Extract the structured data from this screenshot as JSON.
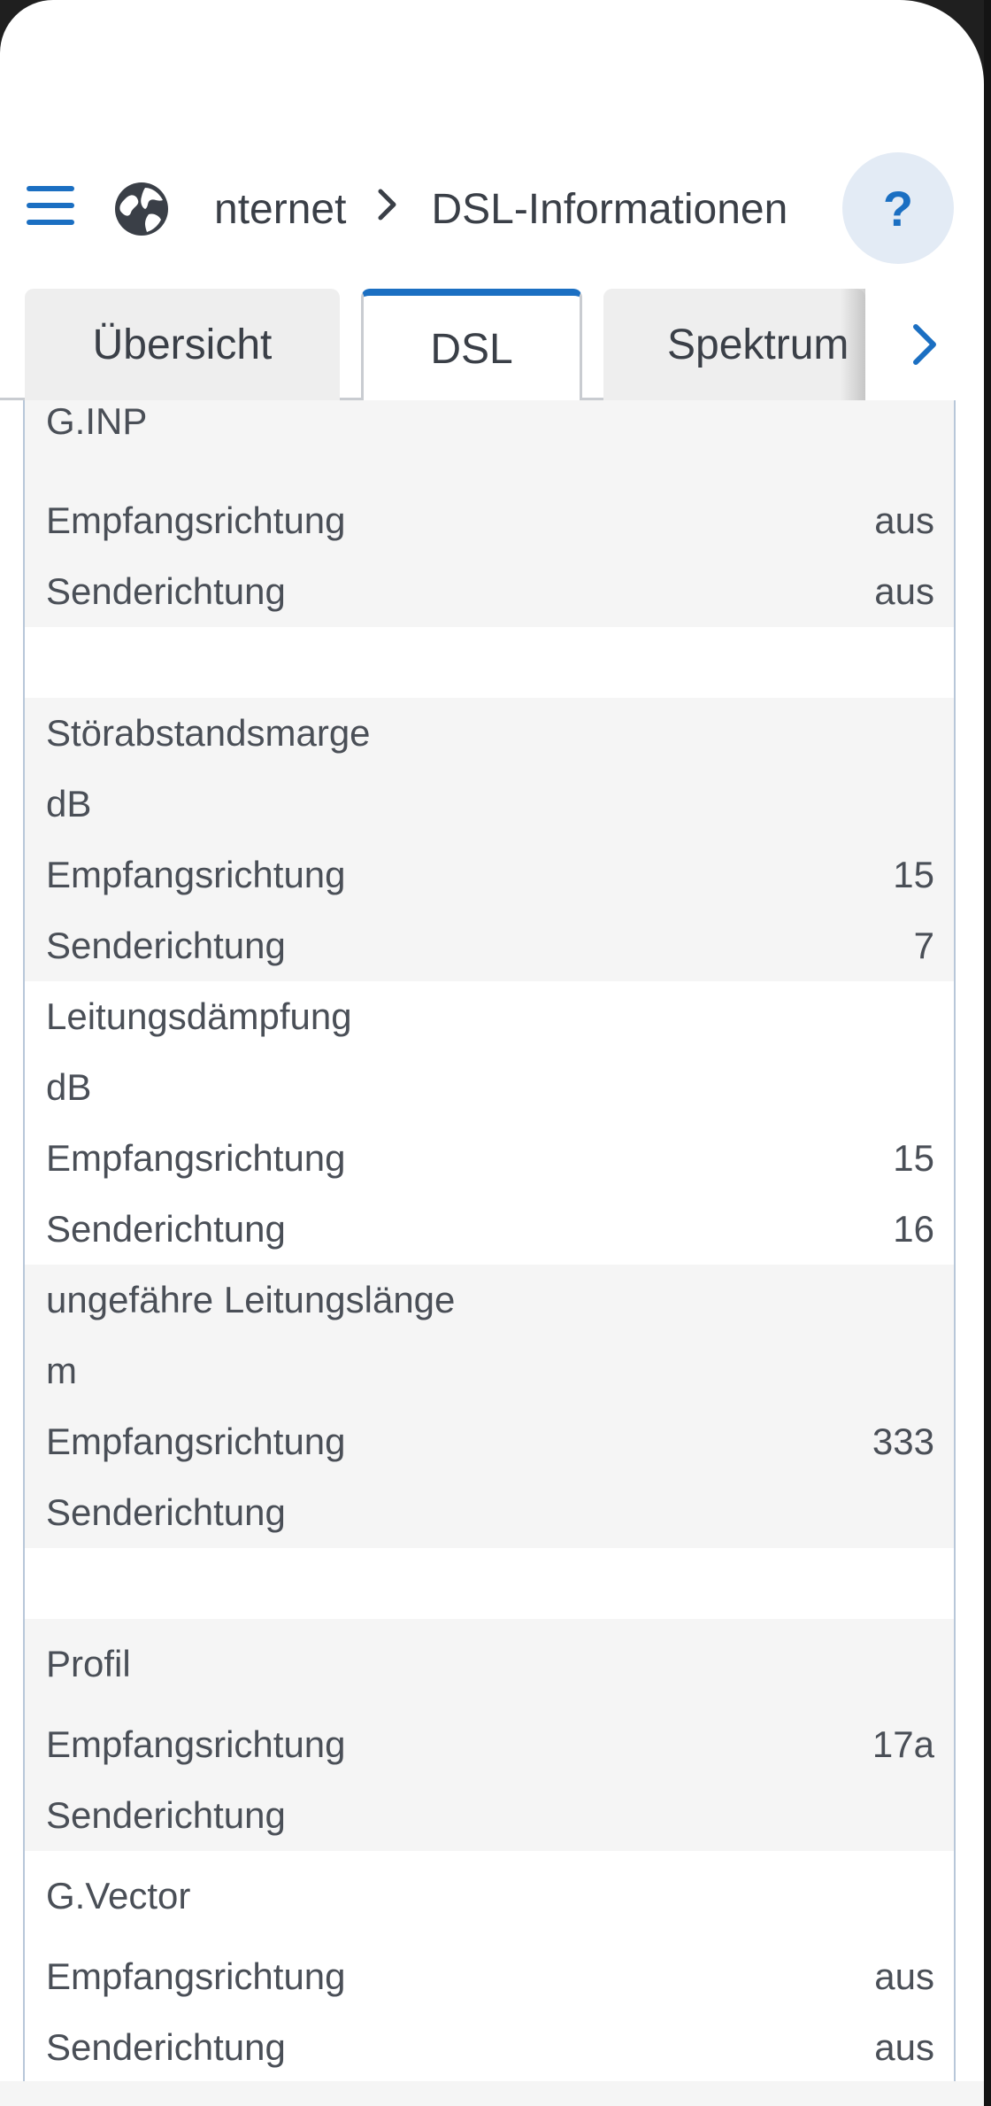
{
  "header": {
    "breadcrumb_parent": "nternet",
    "breadcrumb_current": "DSL-Informationen",
    "help_label": "?",
    "accent_color": "#1b6fc2"
  },
  "tabs": [
    {
      "label": "Übersicht",
      "active": false
    },
    {
      "label": "DSL",
      "active": true
    },
    {
      "label": "Spektrum",
      "active": false
    }
  ],
  "sections": {
    "ginp": {
      "title": "G.INP",
      "rx_label": "Empfangsrichtung",
      "rx_value": "aus",
      "tx_label": "Senderichtung",
      "tx_value": "aus"
    },
    "snr": {
      "title": "Störabstandsmarge",
      "unit": "dB",
      "rx_label": "Empfangsrichtung",
      "rx_value": "15",
      "tx_label": "Senderichtung",
      "tx_value": "7"
    },
    "attenuation": {
      "title": "Leitungsdämpfung",
      "unit": "dB",
      "rx_label": "Empfangsrichtung",
      "rx_value": "15",
      "tx_label": "Senderichtung",
      "tx_value": "16"
    },
    "length": {
      "title": "ungefähre Leitungslänge",
      "unit": "m",
      "rx_label": "Empfangsrichtung",
      "rx_value": "333",
      "tx_label": "Senderichtung",
      "tx_value": ""
    },
    "profile": {
      "title": "Profil",
      "rx_label": "Empfangsrichtung",
      "rx_value": "17a",
      "tx_label": "Senderichtung",
      "tx_value": ""
    },
    "gvector": {
      "title": "G.Vector",
      "rx_label": "Empfangsrichtung",
      "rx_value": "aus",
      "tx_label": "Senderichtung",
      "tx_value": "aus"
    }
  }
}
